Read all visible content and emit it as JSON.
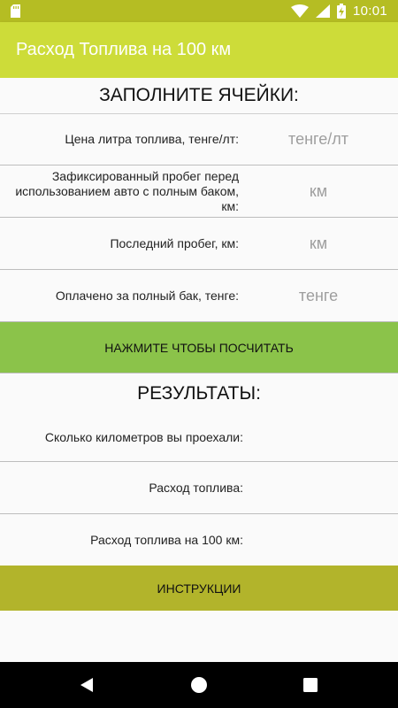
{
  "status_bar": {
    "time": "10:01",
    "icons": [
      "sd-card-icon",
      "wifi-icon",
      "signal-icon",
      "battery-charging-icon"
    ]
  },
  "app_bar": {
    "title": "Расход Топлива на 100 км"
  },
  "form": {
    "heading": "ЗАПОЛНИТЕ ЯЧЕЙКИ:",
    "fields": [
      {
        "label": "Цена литра топлива, тенге/лт:",
        "placeholder": "тенге/лт",
        "value": ""
      },
      {
        "label": "Зафиксированный пробег перед использованием авто с полным баком, км:",
        "placeholder": "км",
        "value": ""
      },
      {
        "label": "Последний пробег, км:",
        "placeholder": "км",
        "value": ""
      },
      {
        "label": "Оплачено за полный бак, тенге:",
        "placeholder": "тенге",
        "value": ""
      }
    ],
    "calculate_label": "НАЖМИТЕ ЧТОБЫ ПОСЧИТАТЬ"
  },
  "results": {
    "heading": "РЕЗУЛЬТАТЫ:",
    "rows": [
      {
        "label": "Сколько километров вы проехали:",
        "value": ""
      },
      {
        "label": "Расход топлива:",
        "value": ""
      },
      {
        "label": "Расход топлива на 100 км:",
        "value": ""
      }
    ],
    "instructions_label": "ИНСТРУКЦИИ"
  },
  "nav_bar": {
    "icons": [
      "back-icon",
      "home-icon",
      "recents-icon"
    ]
  },
  "colors": {
    "status_bar": "#b5bd23",
    "app_bar": "#cddc39",
    "calculate_button": "#8bc34a",
    "instructions_button": "#b2b42b"
  }
}
